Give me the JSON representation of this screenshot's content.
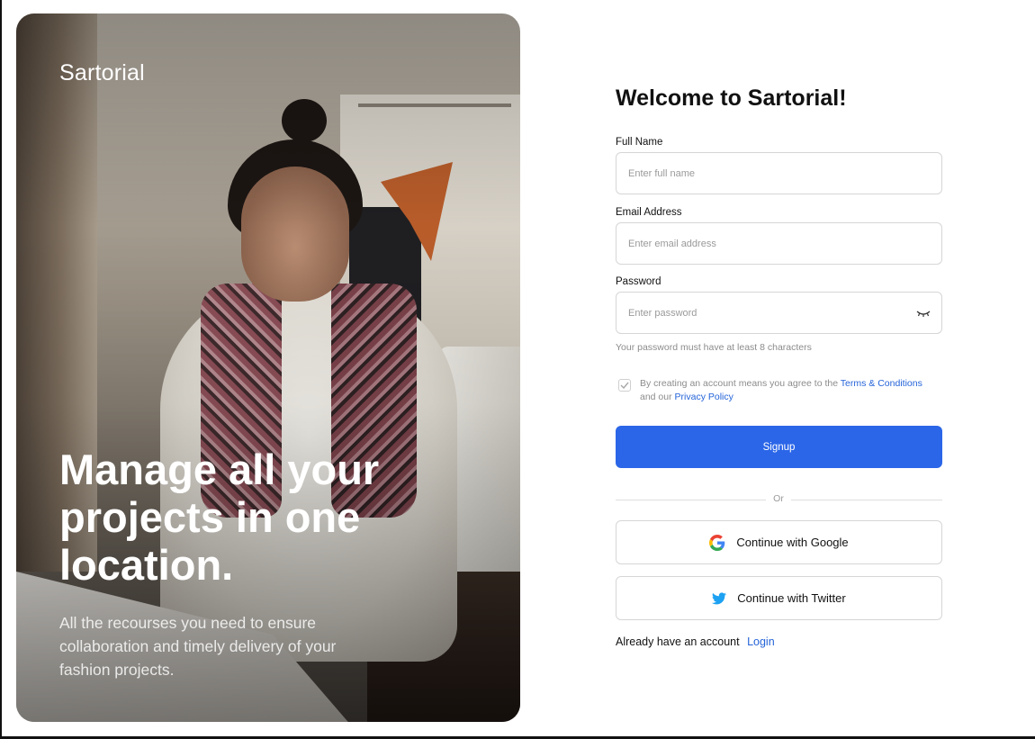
{
  "hero": {
    "brand": "Sartorial",
    "headline": "Manage all your projects in one location.",
    "subtext": "All the recourses you need to ensure collaboration and timely delivery of your fashion projects."
  },
  "form": {
    "title": "Welcome to Sartorial!",
    "full_name": {
      "label": "Full Name",
      "placeholder": "Enter full name",
      "value": ""
    },
    "email": {
      "label": "Email Address",
      "placeholder": "Enter email address",
      "value": ""
    },
    "password": {
      "label": "Password",
      "placeholder": "Enter password",
      "value": "",
      "icon": "eye-closed-icon"
    },
    "password_hint": "Your password must have at least 8 characters",
    "terms": {
      "checked": true,
      "prefix": "By creating an account means you agree to the",
      "terms_link": "Terms & Conditions",
      "middle": "and our",
      "privacy_link": "Privacy Policy"
    },
    "signup_label": "Signup",
    "divider_text": "Or",
    "google_label": "Continue with Google",
    "twitter_label": "Continue with Twitter",
    "login_prompt": "Already have an account",
    "login_link": "Login"
  },
  "colors": {
    "accent": "#2b66e8",
    "link": "#2564d9",
    "twitter": "#1da1f2"
  }
}
